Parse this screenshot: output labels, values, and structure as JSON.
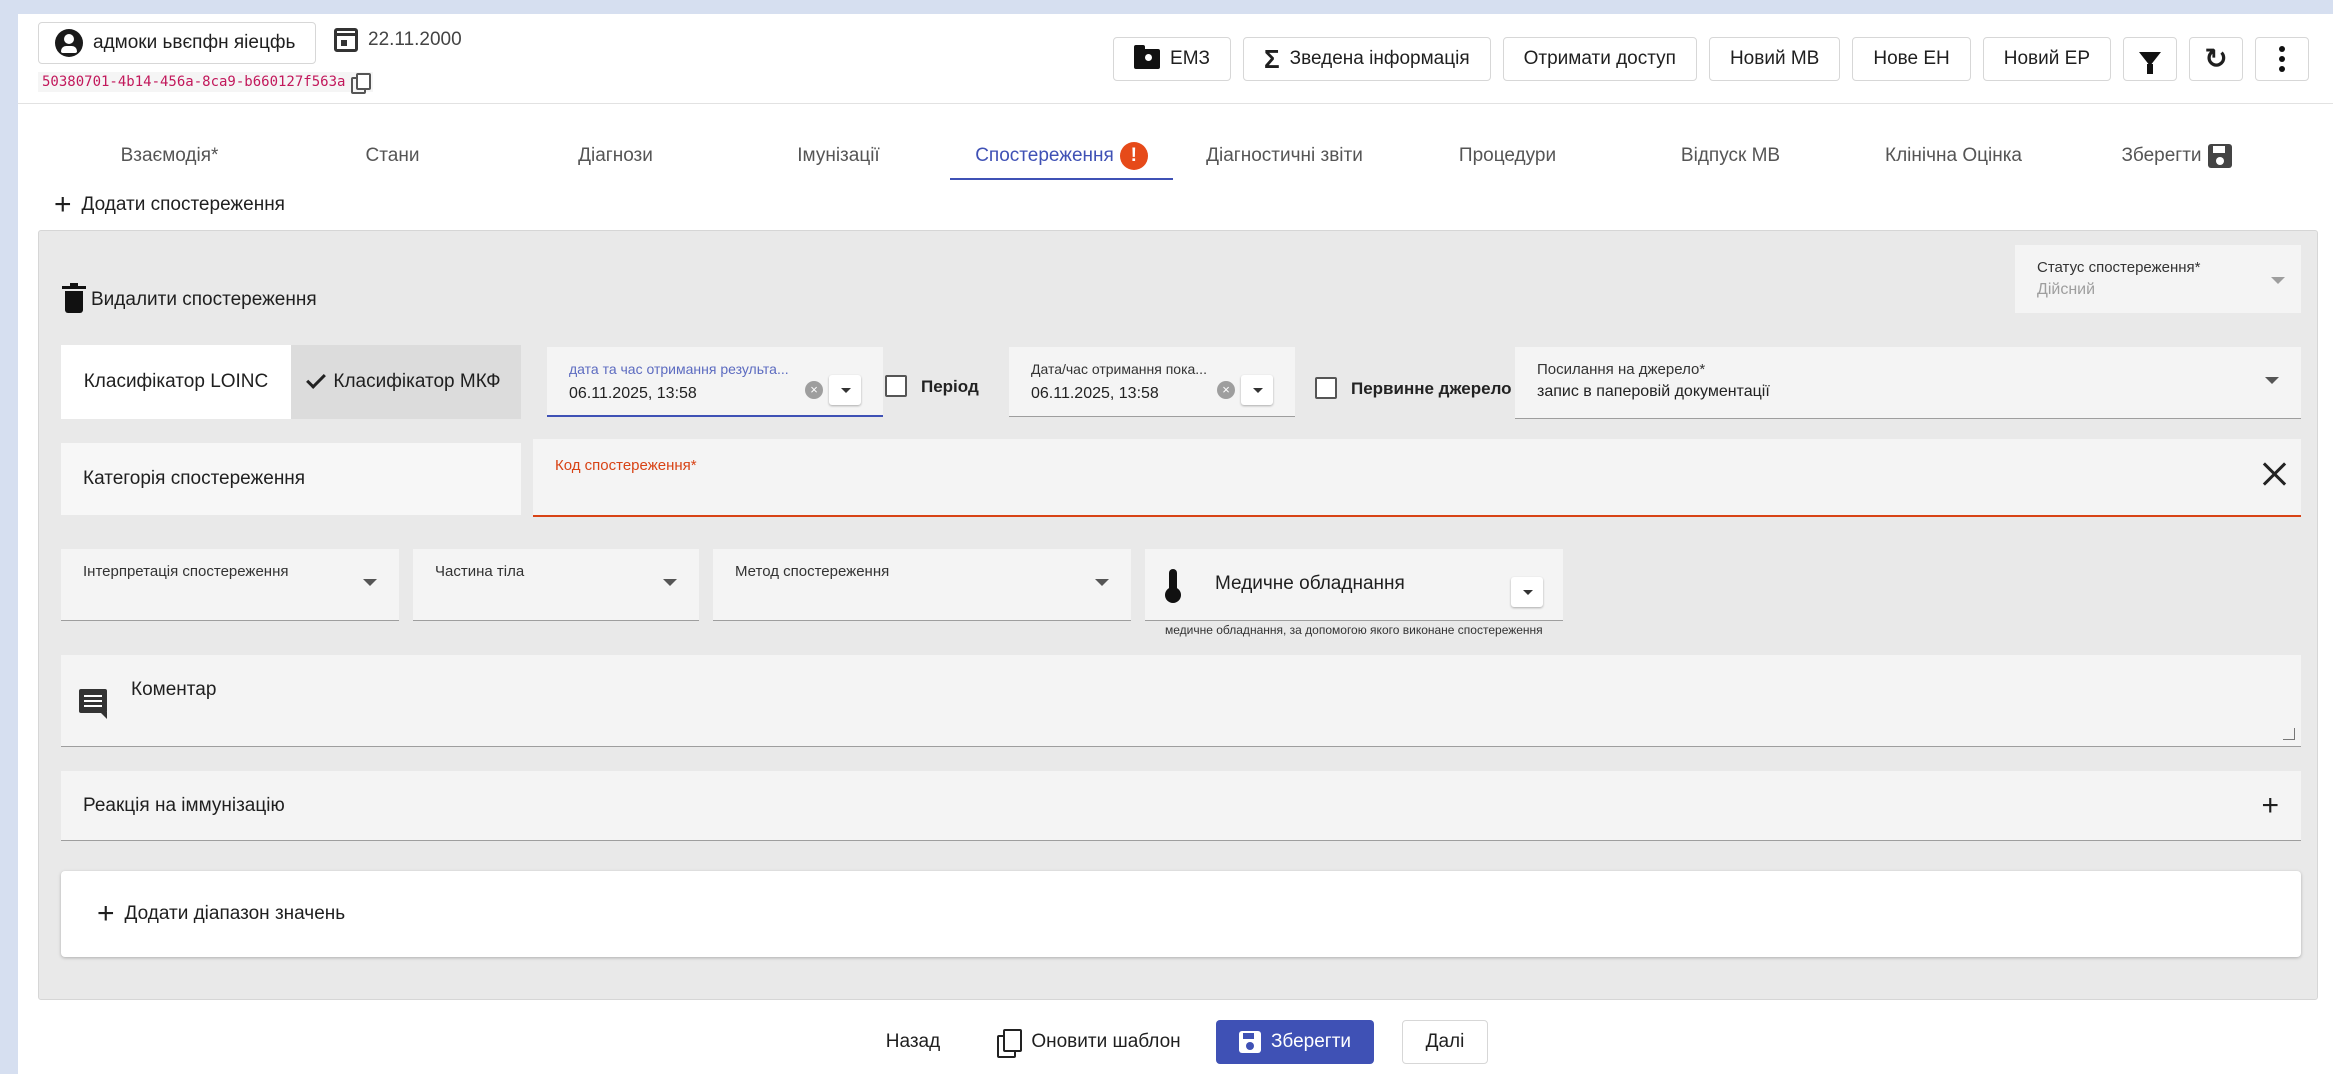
{
  "header": {
    "patient_name": "адмоки ьвєпфн яіецфь",
    "birth_date": "22.11.2000",
    "uuid": "50380701-4b14-456a-8ca9-b660127f563a",
    "toolbar": {
      "emz": "ЕМЗ",
      "summary": "Зведена інформація",
      "get_access": "Отримати доступ",
      "new_mv": "Новий МВ",
      "new_eh": "Нове ЕН",
      "new_ep": "Новий ЕР"
    }
  },
  "tabs": [
    {
      "label": "Взаємодія*"
    },
    {
      "label": "Стани"
    },
    {
      "label": "Діагнози"
    },
    {
      "label": "Імунізації"
    },
    {
      "label": "Спостереження"
    },
    {
      "label": "Діагностичні звіти"
    },
    {
      "label": "Процедури"
    },
    {
      "label": "Відпуск МВ"
    },
    {
      "label": "Клінічна Оцінка"
    },
    {
      "label": "Зберегти"
    }
  ],
  "active_tab": "Спостереження",
  "add_observation": "Додати спостереження",
  "observation": {
    "delete_label": "Видалити спостереження",
    "status": {
      "label": "Статус спостереження*",
      "value": "Дійсний"
    },
    "classifier": {
      "loinc": "Класифікатор LOINC",
      "icf": "Класифікатор МКФ",
      "selected": "Класифікатор МКФ"
    },
    "result_date": {
      "label": "дата та час отримання результа...",
      "value": "06.11.2025, 13:58"
    },
    "period_label": "Період",
    "indicator_date": {
      "label": "Дата/час отримання пока...",
      "value": "06.11.2025, 13:58"
    },
    "primary_source_label": "Первинне джерело",
    "source_ref": {
      "label": "Посилання на джерело*",
      "value": "запис в паперовій документації"
    },
    "category_label": "Категорія спостереження",
    "code_label": "Код спостереження*",
    "interpretation_label": "Інтерпретація спостереження",
    "body_part_label": "Частина тіла",
    "method_label": "Метод спостереження",
    "device": {
      "title": "Медичне обладнання",
      "hint": "медичне обладнання, за допомогою якого виконане спостереження"
    },
    "comment_label": "Коментар",
    "reaction_label": "Реакція на іммунізацію",
    "add_range_label": "Додати діапазон значень"
  },
  "footer": {
    "back": "Назад",
    "update_template": "Оновити шаблон",
    "save": "Зберегти",
    "next": "Далі"
  },
  "colors": {
    "primary": "#3f51b5",
    "error": "#d84315",
    "warning": "#e64a19"
  }
}
